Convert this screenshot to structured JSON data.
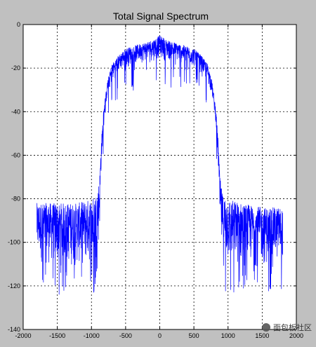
{
  "chart_data": {
    "type": "line",
    "title": "Total Signal Spectrum",
    "xlabel": "",
    "ylabel": "",
    "xlim": [
      -2000,
      2000
    ],
    "ylim": [
      -140,
      0
    ],
    "x_ticks": [
      -2000,
      -1500,
      -1000,
      -500,
      0,
      500,
      1000,
      1500,
      2000
    ],
    "y_ticks": [
      0,
      -20,
      -40,
      -60,
      -80,
      -100,
      -120,
      -140
    ],
    "grid": true,
    "series": [
      {
        "color": "#0000ff",
        "envelope": {
          "x": [
            -1800,
            -1500,
            -1200,
            -1000,
            -920,
            -880,
            -860,
            -820,
            -760,
            -700,
            -600,
            -500,
            -400,
            -300,
            -200,
            -100,
            0,
            100,
            200,
            300,
            400,
            500,
            600,
            700,
            760,
            820,
            860,
            880,
            920,
            1000,
            1200,
            1500,
            1800
          ],
          "upper": [
            -82,
            -82,
            -82,
            -80,
            -77,
            -70,
            -55,
            -38,
            -25,
            -18,
            -14,
            -11,
            -10,
            -9,
            -8,
            -7,
            -5,
            -7,
            -8,
            -9,
            -10,
            -11,
            -14,
            -18,
            -25,
            -38,
            -55,
            -70,
            -78,
            -80,
            -82,
            -84,
            -84
          ],
          "lower": [
            -110,
            -112,
            -112,
            -112,
            -112,
            -95,
            -70,
            -45,
            -32,
            -27,
            -22,
            -20,
            -19,
            -18,
            -17,
            -17,
            -16,
            -17,
            -17,
            -18,
            -19,
            -20,
            -22,
            -27,
            -32,
            -45,
            -70,
            -95,
            -112,
            -112,
            -112,
            -112,
            -110
          ]
        }
      }
    ]
  },
  "watermark": {
    "text": "面包板社区"
  }
}
